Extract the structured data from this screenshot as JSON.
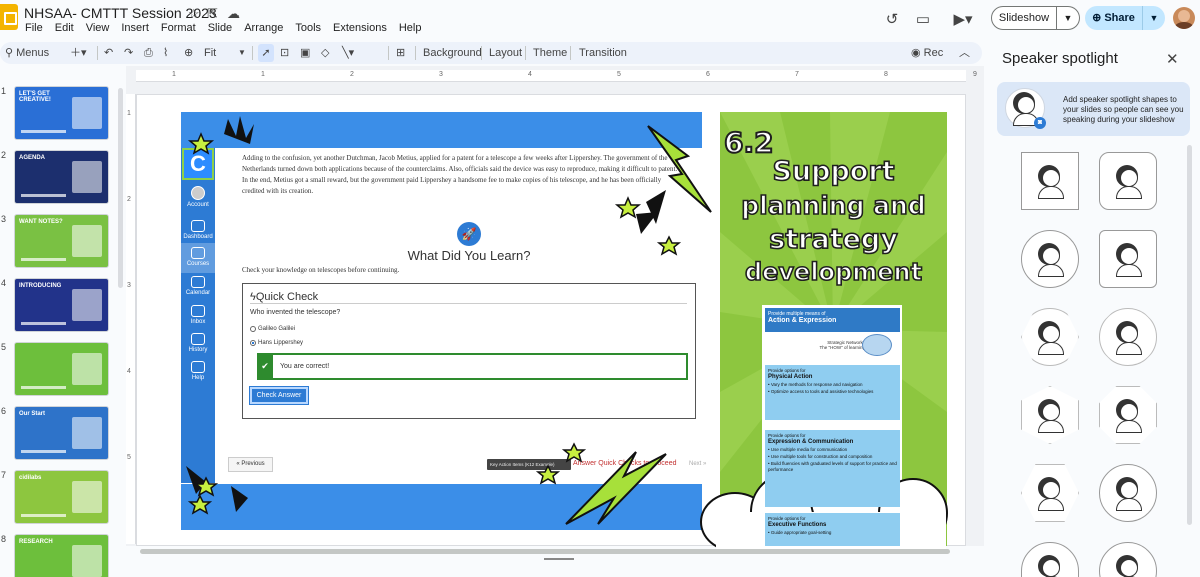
{
  "title_bar": {
    "doc_title": "NHSAA- CMTTT Session 2023",
    "star_icon": "star-icon",
    "move_icon": "folder-icon",
    "cloud_icon": "cloud-status-icon"
  },
  "menu": [
    "File",
    "Edit",
    "View",
    "Insert",
    "Format",
    "Slide",
    "Arrange",
    "Tools",
    "Extensions",
    "Help"
  ],
  "header_actions": {
    "slideshow_label": "Slideshow",
    "share_label": "Share"
  },
  "toolbar": {
    "menus_label": "Menus",
    "zoom_label": "Fit",
    "background_label": "Background",
    "layout_label": "Layout",
    "theme_label": "Theme",
    "transition_label": "Transition",
    "rec_label": "Rec"
  },
  "filmstrip": {
    "slides": [
      {
        "num": "1",
        "bg": "#2a6fd6",
        "text": "LET'S GET CREATIVE!"
      },
      {
        "num": "2",
        "bg": "#1c2f6e",
        "text": "AGENDA"
      },
      {
        "num": "3",
        "bg": "#7ac143",
        "text": "WANT NOTES?"
      },
      {
        "num": "4",
        "bg": "#22338a",
        "text": "INTRODUCING"
      },
      {
        "num": "5",
        "bg": "#6dbf3c",
        "text": ""
      },
      {
        "num": "6",
        "bg": "#2e73c9",
        "text": "Our Start"
      },
      {
        "num": "7",
        "bg": "#8dc63f",
        "text": "cidilabs"
      },
      {
        "num": "8",
        "bg": "#6dbf3c",
        "text": "RESEARCH"
      }
    ]
  },
  "ruler": {
    "h_ticks": [
      "1",
      "1",
      "2",
      "3",
      "4",
      "5",
      "6",
      "7",
      "8",
      "9"
    ],
    "v_ticks": [
      "1",
      "2",
      "3",
      "4",
      "5"
    ]
  },
  "slide": {
    "canvas_nav": {
      "logo": "C",
      "items": [
        "Account",
        "Dashboard",
        "Courses",
        "Calendar",
        "Inbox",
        "History",
        "Help"
      ]
    },
    "paragraph": "Adding to the confusion, yet another Dutchman, Jacob Metius, applied for a patent for a telescope a few weeks after Lippershey. The government of the Netherlands turned down both applications because of the counterclaims. Also, officials said the device was easy to reproduce, making it difficult to patent. In the end, Metius got a small reward, but the government paid Lippershey a handsome fee to make copies of his telescope, and he has been officially credited with its creation.",
    "quiz_heading": "What Did You Learn?",
    "quiz_sub": "Check your knowledge on telescopes before continuing.",
    "quick_check_title": "Quick Check",
    "question": "Who invented the telescope?",
    "options": [
      "Galileo Galilei",
      "Hans Lippershey"
    ],
    "feedback": "You are correct!",
    "check_answer": "Check Answer",
    "previous": "« Previous",
    "next": "Next »",
    "warning": "Answer Quick Checks to proceed",
    "tooltip": "Key Action Items (K12 Example)"
  },
  "poster": {
    "number": "6.2",
    "title_lines": [
      "Support",
      "planning and",
      "strategy",
      "development"
    ],
    "udl_header_small": "Provide multiple means of",
    "udl_header": "Action & Expression",
    "udl_network": "Strategic Networks",
    "udl_network_sub": "The \"HOW\" of learning",
    "sections": [
      {
        "pre": "Provide options for",
        "title": "Physical Action",
        "items": [
          "Vary the methods for response and navigation",
          "Optimize access to tools and assistive technologies"
        ]
      },
      {
        "pre": "Provide options for",
        "title": "Expression & Communication",
        "items": [
          "Use multiple media for communication",
          "Use multiple tools for construction and composition",
          "Build fluencies with graduated levels of support for practice and performance"
        ]
      },
      {
        "pre": "Provide options for",
        "title": "Executive Functions",
        "items": [
          "Guide appropriate goal-setting"
        ]
      }
    ]
  },
  "speaker_panel": {
    "title": "Speaker spotlight",
    "tip": "Add speaker spotlight shapes to your slides so people can see you speaking during your slideshow"
  },
  "colors": {
    "canvas_blue": "#3b8ee8",
    "poster_green": "#8dc63f",
    "share_blue": "#c2e7ff",
    "correct_green": "#2e8b2e"
  }
}
